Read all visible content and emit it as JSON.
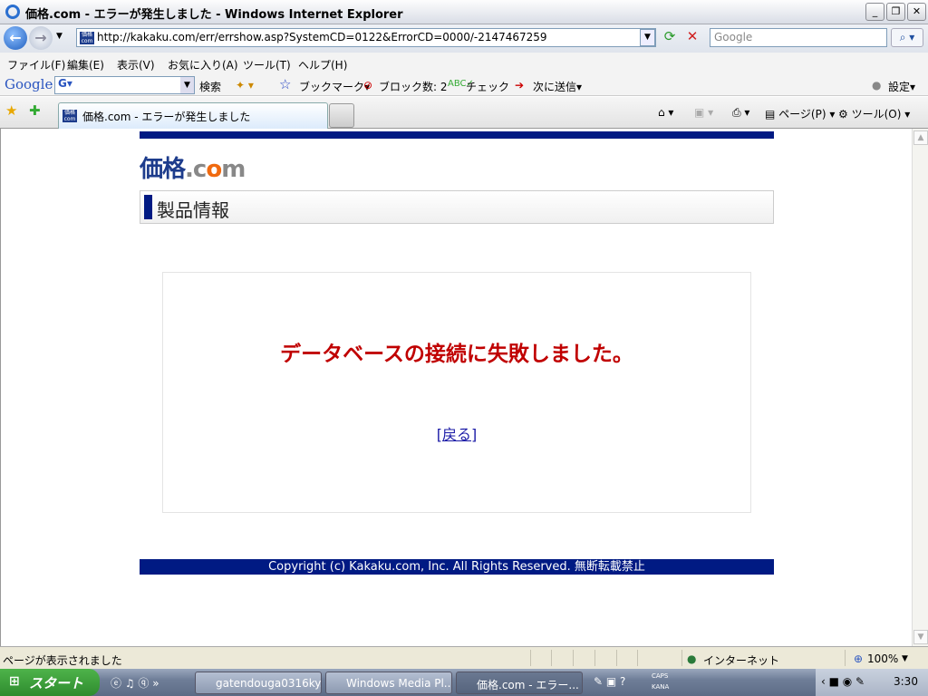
{
  "window": {
    "title": "価格.com - エラーが発生しました - Windows Internet Explorer"
  },
  "address": {
    "url": "http://kakaku.com/err/errshow.asp?SystemCD=0122&ErrorCD=0000/-2147467259",
    "search_placeholder": "Google"
  },
  "menu": [
    "ファイル(F)",
    "編集(E)",
    "表示(V)",
    "お気に入り(A)",
    "ツール(T)",
    "ヘルプ(H)"
  ],
  "google_toolbar": {
    "logo": "Google",
    "search": "検索",
    "bookmark": "ブックマーク▾",
    "block": "ブロック数: 2",
    "check": "チェック",
    "send": "次に送信▾",
    "settings": "設定▾"
  },
  "tab": {
    "label": "価格.com - エラーが発生しました"
  },
  "command_bar": {
    "page": "ページ(P)",
    "tools": "ツール(O)"
  },
  "page": {
    "logo": "価格.com",
    "heading": "製品情報",
    "error_message": "データベースの接続に失敗しました。",
    "back_link": "[戻る]",
    "footer": "Copyright (c) Kakaku.com, Inc. All Rights Reserved. 無断転載禁止"
  },
  "status": {
    "text": "ページが表示されました",
    "zone": "インターネット",
    "zoom": "100%"
  },
  "taskbar": {
    "start": "スタート",
    "tasks": [
      "gatendouga0316ky...",
      "Windows Media Pl...",
      "価格.com - エラー..."
    ],
    "caps": "CAPS",
    "kana": "KANA",
    "clock": "3:30"
  },
  "colors": {
    "brand_navy": "#001a83",
    "error_red": "#c00000"
  }
}
